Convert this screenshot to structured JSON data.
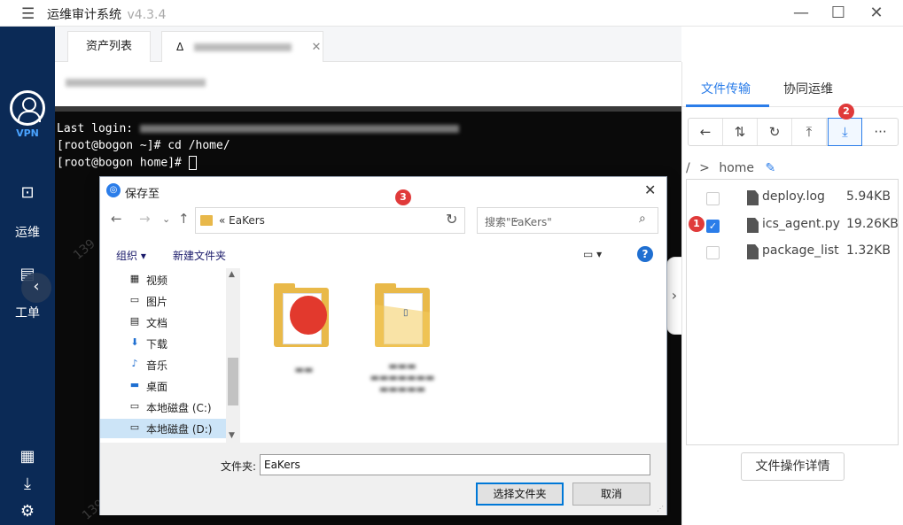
{
  "app": {
    "title": "运维审计系统",
    "version": "v4.3.4"
  },
  "window": {
    "minimize_icon": "minimize-icon",
    "maximize_icon": "maximize-icon",
    "close_icon": "close-icon"
  },
  "leftnav": {
    "vpn_label": "VPN",
    "items": [
      {
        "label": "运维",
        "icon": "monitor-search-icon"
      },
      {
        "label": "工单",
        "icon": "clipboard-icon"
      }
    ],
    "bottom_icons": [
      "keyboard-icon",
      "download-icon",
      "gear-icon"
    ]
  },
  "tabs": [
    {
      "label": "资产列表"
    },
    {
      "label": "",
      "icon": "linux-icon"
    }
  ],
  "terminal": {
    "lines": [
      "Last login: ",
      "[root@bogon ~]# cd /home/",
      "[root@bogon home]# "
    ]
  },
  "right_panel": {
    "tabs": [
      "文件传输",
      "协同运维"
    ],
    "toolbar": [
      "back-icon",
      "sort-icon",
      "refresh-icon",
      "upload-icon",
      "download-icon",
      "more-icon"
    ],
    "breadcrumb": {
      "root": "/",
      "sep": ">",
      "current": "home"
    },
    "files": [
      {
        "name": "deploy.log",
        "size": "5.94KB",
        "checked": false
      },
      {
        "name": "ics_agent.py",
        "size": "19.26KB",
        "checked": true
      },
      {
        "name": "package_list",
        "size": "1.32KB",
        "checked": false
      }
    ],
    "detail_button": "文件操作详情"
  },
  "badges": [
    "1",
    "2",
    "3"
  ],
  "dialog": {
    "title": "保存至",
    "address": "« EaKers",
    "search_placeholder": "搜索\"EaKers\"",
    "organize": "组织 ▾",
    "new_folder": "新建文件夹",
    "help": "?",
    "tree": [
      {
        "label": "视频",
        "icon": "video-icon"
      },
      {
        "label": "图片",
        "icon": "picture-icon"
      },
      {
        "label": "文档",
        "icon": "document-icon"
      },
      {
        "label": "下载",
        "icon": "download-arrow-icon"
      },
      {
        "label": "音乐",
        "icon": "music-icon"
      },
      {
        "label": "桌面",
        "icon": "desktop-icon"
      },
      {
        "label": "本地磁盘 (C:)",
        "icon": "drive-icon"
      },
      {
        "label": "本地磁盘 (D:)",
        "icon": "drive-icon"
      }
    ],
    "folder_label": "文件夹:",
    "folder_value": "EaKers",
    "select_button": "选择文件夹",
    "cancel_button": "取消"
  },
  "colors": {
    "nav_bg": "#0b2a56",
    "accent": "#2b7de9",
    "badge": "#e03a3a",
    "terminal_bg": "#0a0a0a"
  }
}
